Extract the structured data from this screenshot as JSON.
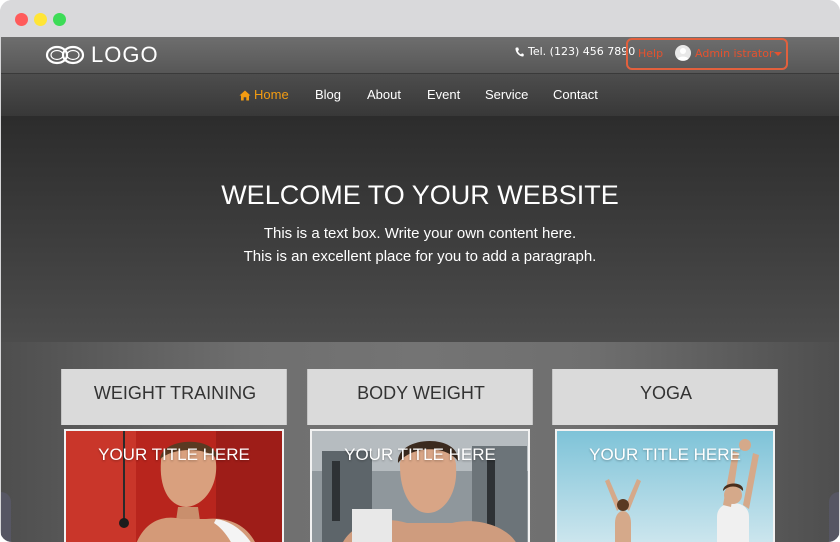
{
  "header": {
    "logo_text": "LOGO",
    "tel": "Tel. (123) 456 7890",
    "help": "Help",
    "username": "Admin istrator"
  },
  "nav": {
    "items": [
      {
        "label": "Home",
        "active": true
      },
      {
        "label": "Blog"
      },
      {
        "label": "About"
      },
      {
        "label": "Event"
      },
      {
        "label": "Service"
      },
      {
        "label": "Contact"
      }
    ]
  },
  "hero": {
    "title": "WELCOME TO YOUR WEBSITE",
    "line1": "This is a text box. Write your own content here.",
    "line2": "This is an excellent place for you to add a paragraph."
  },
  "cards": [
    {
      "title": "WEIGHT TRAINING",
      "image_title": "YOUR TITLE HERE"
    },
    {
      "title": "BODY WEIGHT",
      "image_title": "YOUR TITLE HERE"
    },
    {
      "title": "YOGA",
      "image_title": "YOUR TITLE HERE"
    }
  ],
  "colors": {
    "accent_orange": "#f39c12",
    "user_red": "#e5522f",
    "close_dot": "#ff5b5b",
    "minimize_dot": "#ffe536",
    "maximize_dot": "#3ddc57"
  },
  "icons": [
    "infinity-logo-icon",
    "phone-icon",
    "avatar-icon",
    "home-icon",
    "chevron-down-icon"
  ]
}
